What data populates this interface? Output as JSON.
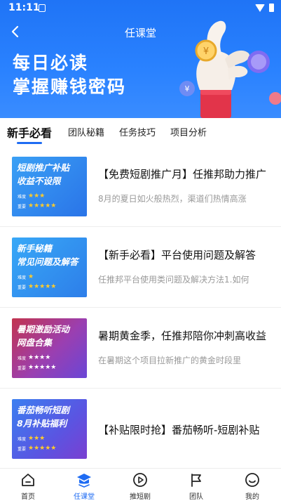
{
  "status_bar": {
    "time": "11:11"
  },
  "header": {
    "title": "任课堂",
    "headline_line1": "每日必读",
    "headline_line2": "掌握赚钱密码"
  },
  "tabs": [
    {
      "label": "新手必看",
      "active": true
    },
    {
      "label": "团队秘籍",
      "active": false
    },
    {
      "label": "任务技巧",
      "active": false
    },
    {
      "label": "项目分析",
      "active": false
    }
  ],
  "articles": [
    {
      "thumb_line1": "短剧推广补贴",
      "thumb_line2": "收益不设限",
      "difficulty_label": "难度",
      "importance_label": "重要",
      "difficulty_stars": "★★★",
      "importance_stars": "★★★★★",
      "title": "【免费短剧推广月】任推邦助力推广",
      "desc": "8月的夏日如火般热烈，渠道们热情高涨"
    },
    {
      "thumb_line1": "新手秘籍",
      "thumb_line2": "常见问题及解答",
      "difficulty_label": "难度",
      "importance_label": "重要",
      "difficulty_stars": "★",
      "importance_stars": "★★★★★",
      "title": "【新手必看】平台使用问题及解答",
      "desc": "任推邦平台使用类问题及解决方法1.如何"
    },
    {
      "thumb_line1": "暑期激励活动",
      "thumb_line2": "网盘合集",
      "difficulty_label": "难度",
      "importance_label": "重要",
      "difficulty_stars": "★★★★",
      "importance_stars": "★★★★★",
      "title": "暑期黄金季，任推邦陪你冲刺高收益",
      "desc": "在暑期这个项目拉新推广的黄金时段里"
    },
    {
      "thumb_line1": "番茄畅听短剧",
      "thumb_line2": "8月补贴福利",
      "difficulty_label": "难度",
      "importance_label": "重要",
      "difficulty_stars": "★★★",
      "importance_stars": "★★★★★",
      "title": "【补贴限时抢】番茄畅听-短剧补贴",
      "desc": ""
    }
  ],
  "bottom_nav": [
    {
      "label": "首页",
      "icon": "home-icon",
      "active": false
    },
    {
      "label": "任课堂",
      "icon": "graduation-cap-icon",
      "active": true
    },
    {
      "label": "推短剧",
      "icon": "play-icon",
      "active": false
    },
    {
      "label": "团队",
      "icon": "flag-icon",
      "active": false
    },
    {
      "label": "我的",
      "icon": "smiley-icon",
      "active": false
    }
  ],
  "colors": {
    "brand_blue": "#1f6cf3",
    "hero_blue": "#2a82ff",
    "thumb_blue": "#2f8cf0",
    "thumb_purple": "#7a3fd1",
    "thumb_red": "#c23a5a"
  }
}
